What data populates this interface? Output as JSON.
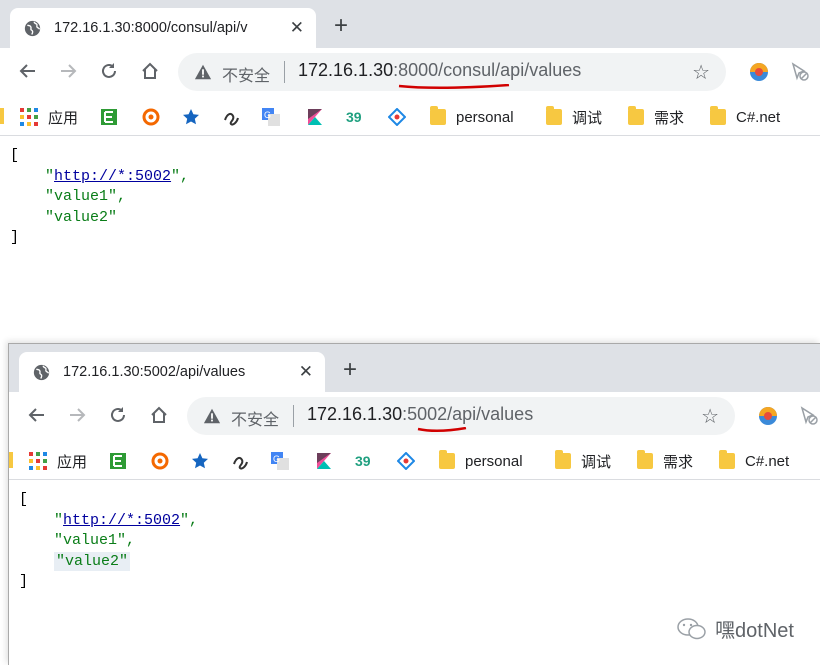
{
  "windows": [
    {
      "tab": {
        "title": "172.16.1.30:8000/consul/api/v",
        "close": "✕"
      },
      "new_tab": "+",
      "omnibox": {
        "security": "不安全",
        "host": "172.16.1.30",
        "port_path": ":8000/consul",
        "rest": "/api/values"
      },
      "bookmarks": [
        "应用",
        "personal",
        "调试",
        "需求",
        "C#.net"
      ],
      "response": {
        "open": "[",
        "url": "http://*:5002",
        "value1": "value1",
        "value2": "value2",
        "close": "]"
      }
    },
    {
      "tab": {
        "title": "172.16.1.30:5002/api/values",
        "close": "✕"
      },
      "new_tab": "+",
      "omnibox": {
        "security": "不安全",
        "host": "172.16.1.30",
        "port_path": ":5002",
        "rest": "/api/values"
      },
      "bookmarks": [
        "应用",
        "personal",
        "调试",
        "需求",
        "C#.net"
      ],
      "response": {
        "open": "[",
        "url": "http://*:5002",
        "value1": "value1",
        "value2": "value2",
        "close": "]"
      }
    }
  ],
  "watermark": "嘿dotNet",
  "colors": {
    "tabstrip": "#dee1e6",
    "omnibox": "#f1f3f4",
    "annotation": "#d10000",
    "link": "#00009e",
    "string": "#0a7d18"
  }
}
